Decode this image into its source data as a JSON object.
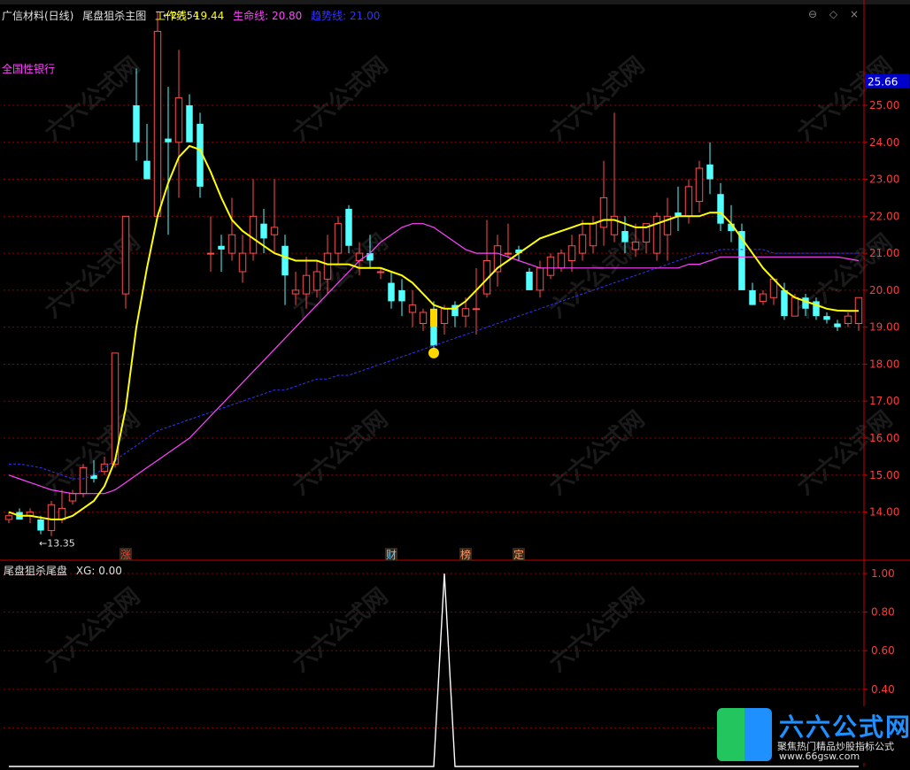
{
  "header": {
    "stock": "广信材料(日线)",
    "indicator": "尾盘狙杀主图",
    "work_label": "工作线: 19.44",
    "life_label": "生命线: 20.80",
    "trend_label": "趋势线: 21.00"
  },
  "sector": "全国性银行",
  "window_controls": [
    "⊖",
    "◇",
    "×"
  ],
  "sub_panel": {
    "title": "尾盘狙杀尾盘",
    "xg_label": "XG: 0.00"
  },
  "price_tag": "25.66",
  "annotations": {
    "high": "27.54",
    "low": "13.35"
  },
  "events": [
    {
      "label": "涨",
      "index": 11,
      "color": "#ff3333"
    },
    {
      "label": "财",
      "index": 36,
      "color": "#66ccff"
    },
    {
      "label": "榜",
      "index": 43,
      "color": "#ff9966"
    },
    {
      "label": "定",
      "index": 48,
      "color": "#ff9966"
    }
  ],
  "watermark": {
    "text": "六六公式网"
  },
  "logo": {
    "name": "六六公式网",
    "slogan": "聚焦热门精品炒股指标公式",
    "url": "www.66gsw.com"
  },
  "colors": {
    "up": "#ff4d4d",
    "down": "#54ffff",
    "work": "#ffff00",
    "life": "#ff44ff",
    "trend": "#3333ff",
    "grid": "#8b0000",
    "axis": "#cc0000"
  },
  "chart_data": [
    {
      "type": "candlestick",
      "title": "尾盘狙杀主图",
      "ylim": [
        13.2,
        27.8
      ],
      "yticks": [
        14.0,
        15.0,
        16.0,
        17.0,
        18.0,
        19.0,
        20.0,
        21.0,
        22.0,
        23.0,
        24.0,
        25.0
      ],
      "ohlc": [
        [
          13.8,
          14.0,
          13.7,
          13.9
        ],
        [
          14.0,
          14.1,
          13.8,
          13.8
        ],
        [
          13.9,
          14.1,
          13.7,
          14.0
        ],
        [
          13.8,
          13.9,
          13.4,
          13.5
        ],
        [
          13.5,
          14.3,
          13.35,
          14.2
        ],
        [
          13.8,
          14.6,
          13.7,
          14.1
        ],
        [
          14.3,
          14.6,
          14.2,
          14.5
        ],
        [
          14.5,
          15.3,
          14.4,
          15.2
        ],
        [
          15.0,
          15.4,
          14.8,
          14.9
        ],
        [
          15.1,
          15.5,
          15.0,
          15.3
        ],
        [
          15.3,
          18.3,
          15.2,
          18.3
        ],
        [
          19.9,
          22.0,
          19.5,
          22.0
        ],
        [
          25.0,
          26.0,
          23.5,
          24.0
        ],
        [
          23.5,
          24.5,
          23.0,
          23.0
        ],
        [
          22.0,
          27.54,
          22.0,
          27.0
        ],
        [
          24.1,
          25.5,
          21.5,
          24.0
        ],
        [
          24.0,
          26.5,
          22.5,
          25.2
        ],
        [
          25.0,
          25.3,
          24.0,
          24.0
        ],
        [
          24.5,
          24.8,
          22.5,
          22.8
        ],
        [
          21.0,
          22.0,
          20.5,
          21.0
        ],
        [
          21.2,
          21.5,
          20.5,
          21.1
        ],
        [
          21.0,
          22.5,
          20.8,
          21.5
        ],
        [
          20.5,
          21.5,
          20.2,
          21.0
        ],
        [
          21.0,
          23.0,
          20.8,
          22.0
        ],
        [
          21.8,
          22.2,
          21.0,
          21.4
        ],
        [
          21.5,
          23.0,
          21.0,
          21.7
        ],
        [
          21.2,
          21.5,
          19.6,
          20.4
        ],
        [
          19.9,
          20.5,
          19.6,
          20.0
        ],
        [
          19.9,
          20.9,
          19.5,
          20.4
        ],
        [
          20.0,
          20.8,
          19.8,
          20.5
        ],
        [
          20.3,
          21.5,
          19.9,
          21.0
        ],
        [
          21.0,
          22.0,
          20.7,
          21.8
        ],
        [
          22.2,
          22.3,
          21.0,
          21.2
        ],
        [
          20.8,
          21.3,
          20.4,
          21.0
        ],
        [
          21.0,
          21.5,
          20.6,
          20.8
        ],
        [
          20.5,
          20.6,
          20.3,
          20.5
        ],
        [
          20.2,
          20.5,
          19.5,
          19.7
        ],
        [
          20.0,
          20.3,
          19.3,
          19.7
        ],
        [
          19.4,
          20.0,
          19.0,
          19.6
        ],
        [
          19.1,
          19.5,
          18.9,
          19.4
        ],
        [
          19.2,
          19.7,
          18.4,
          18.5
        ],
        [
          19.1,
          19.6,
          18.8,
          19.5
        ],
        [
          19.6,
          19.7,
          19.0,
          19.3
        ],
        [
          19.3,
          19.8,
          19.0,
          19.5
        ],
        [
          19.5,
          20.6,
          18.8,
          19.5
        ],
        [
          19.9,
          21.9,
          19.8,
          20.8
        ],
        [
          20.5,
          21.5,
          20.1,
          21.2
        ],
        [
          21.0,
          21.8,
          20.9,
          21.0
        ],
        [
          21.1,
          21.2,
          20.8,
          21.0
        ],
        [
          20.5,
          20.6,
          20.0,
          20.0
        ],
        [
          20.0,
          20.8,
          19.8,
          20.6
        ],
        [
          20.4,
          21.0,
          20.3,
          20.9
        ],
        [
          20.6,
          21.1,
          20.5,
          21.0
        ],
        [
          20.8,
          21.5,
          20.5,
          21.2
        ],
        [
          21.0,
          21.9,
          20.8,
          21.5
        ],
        [
          21.2,
          22.0,
          21.0,
          21.8
        ],
        [
          21.7,
          23.5,
          21.2,
          22.5
        ],
        [
          21.5,
          24.8,
          21.3,
          22.0
        ],
        [
          21.6,
          22.0,
          21.0,
          21.3
        ],
        [
          21.1,
          21.8,
          20.9,
          21.3
        ],
        [
          21.3,
          21.8,
          21.0,
          21.8
        ],
        [
          21.0,
          22.1,
          20.8,
          22.0
        ],
        [
          21.5,
          22.5,
          20.8,
          22.0
        ],
        [
          22.1,
          22.8,
          21.6,
          22.0
        ],
        [
          22.0,
          23.0,
          21.8,
          22.8
        ],
        [
          22.4,
          23.5,
          22.1,
          23.3
        ],
        [
          23.4,
          24.0,
          22.6,
          23.0
        ],
        [
          22.6,
          22.9,
          21.6,
          21.8
        ],
        [
          21.8,
          22.3,
          21.3,
          21.6
        ],
        [
          21.6,
          21.8,
          20.0,
          20.0
        ],
        [
          20.0,
          20.2,
          19.6,
          19.6
        ],
        [
          19.7,
          20.0,
          19.6,
          19.9
        ],
        [
          19.8,
          20.3,
          19.6,
          20.3
        ],
        [
          20.0,
          20.2,
          19.2,
          19.3
        ],
        [
          19.3,
          19.9,
          19.3,
          19.8
        ],
        [
          19.8,
          19.9,
          19.3,
          19.5
        ],
        [
          19.7,
          19.8,
          19.2,
          19.3
        ],
        [
          19.3,
          19.4,
          19.1,
          19.2
        ],
        [
          19.1,
          19.2,
          18.9,
          19.0
        ],
        [
          19.1,
          19.4,
          19.0,
          19.3
        ],
        [
          19.1,
          19.8,
          18.9,
          19.8
        ]
      ],
      "series": [
        {
          "name": "工作线",
          "color": "#ffff00",
          "values": [
            14.0,
            13.9,
            13.9,
            13.85,
            13.8,
            13.8,
            13.9,
            14.1,
            14.3,
            14.7,
            15.4,
            16.8,
            19.0,
            20.6,
            22.0,
            22.9,
            23.6,
            23.9,
            23.8,
            23.2,
            22.5,
            21.9,
            21.6,
            21.4,
            21.2,
            21.0,
            20.9,
            20.8,
            20.8,
            20.8,
            20.7,
            20.7,
            20.7,
            20.6,
            20.6,
            20.6,
            20.5,
            20.4,
            20.2,
            19.9,
            19.6,
            19.5,
            19.5,
            19.7,
            20.0,
            20.3,
            20.6,
            20.8,
            21.0,
            21.2,
            21.4,
            21.5,
            21.6,
            21.7,
            21.8,
            21.8,
            21.9,
            21.9,
            21.8,
            21.7,
            21.7,
            21.8,
            21.9,
            22.0,
            22.0,
            22.0,
            22.1,
            22.1,
            21.8,
            21.4,
            21.0,
            20.6,
            20.3,
            20.0,
            19.8,
            19.7,
            19.6,
            19.5,
            19.45,
            19.44,
            19.44
          ]
        },
        {
          "name": "生命线",
          "color": "#ff44ff",
          "values": [
            15.0,
            14.9,
            14.8,
            14.7,
            14.6,
            14.55,
            14.5,
            14.5,
            14.5,
            14.5,
            14.6,
            14.8,
            15.0,
            15.2,
            15.4,
            15.6,
            15.8,
            16.0,
            16.3,
            16.6,
            16.9,
            17.2,
            17.5,
            17.8,
            18.1,
            18.4,
            18.7,
            19.0,
            19.3,
            19.6,
            19.9,
            20.2,
            20.5,
            20.8,
            21.0,
            21.3,
            21.5,
            21.7,
            21.8,
            21.8,
            21.7,
            21.5,
            21.3,
            21.1,
            21.0,
            21.0,
            21.0,
            20.9,
            20.8,
            20.7,
            20.6,
            20.6,
            20.6,
            20.6,
            20.6,
            20.6,
            20.6,
            20.6,
            20.6,
            20.6,
            20.6,
            20.6,
            20.6,
            20.6,
            20.7,
            20.7,
            20.8,
            20.9,
            20.9,
            20.9,
            20.9,
            20.9,
            20.9,
            20.9,
            20.9,
            20.9,
            20.9,
            20.9,
            20.9,
            20.85,
            20.8
          ]
        },
        {
          "name": "趋势线",
          "color": "#3333ff",
          "values": [
            15.3,
            15.3,
            15.25,
            15.2,
            15.1,
            15.0,
            14.9,
            14.9,
            15.0,
            15.2,
            15.4,
            15.6,
            15.8,
            16.0,
            16.2,
            16.3,
            16.4,
            16.5,
            16.6,
            16.7,
            16.8,
            16.9,
            17.0,
            17.1,
            17.2,
            17.3,
            17.3,
            17.4,
            17.5,
            17.6,
            17.6,
            17.7,
            17.7,
            17.8,
            17.9,
            18.0,
            18.1,
            18.2,
            18.3,
            18.4,
            18.5,
            18.6,
            18.7,
            18.8,
            18.9,
            19.0,
            19.1,
            19.2,
            19.3,
            19.4,
            19.5,
            19.6,
            19.7,
            19.8,
            19.9,
            20.0,
            20.1,
            20.2,
            20.3,
            20.4,
            20.5,
            20.6,
            20.7,
            20.8,
            20.9,
            21.0,
            21.0,
            21.1,
            21.1,
            21.1,
            21.1,
            21.1,
            21.0,
            21.0,
            21.0,
            21.0,
            21.0,
            21.0,
            21.0,
            21.0,
            21.0
          ]
        }
      ]
    },
    {
      "type": "line",
      "title": "尾盘狙杀尾盘",
      "ylim": [
        0,
        1.0
      ],
      "yticks": [
        0.2,
        0.4,
        0.6,
        0.8,
        1.0
      ],
      "series": [
        {
          "name": "XG",
          "color": "#ffffff",
          "values": [
            0,
            0,
            0,
            0,
            0,
            0,
            0,
            0,
            0,
            0,
            0,
            0,
            0,
            0,
            0,
            0,
            0,
            0,
            0,
            0,
            0,
            0,
            0,
            0,
            0,
            0,
            0,
            0,
            0,
            0,
            0,
            0,
            0,
            0,
            0,
            0,
            0,
            0,
            0,
            0,
            0,
            1,
            0,
            0,
            0,
            0,
            0,
            0,
            0,
            0,
            0,
            0,
            0,
            0,
            0,
            0,
            0,
            0,
            0,
            0,
            0,
            0,
            0,
            0,
            0,
            0,
            0,
            0,
            0,
            0,
            0,
            0,
            0,
            0,
            0,
            0,
            0,
            0,
            0,
            0,
            0
          ]
        }
      ]
    }
  ]
}
